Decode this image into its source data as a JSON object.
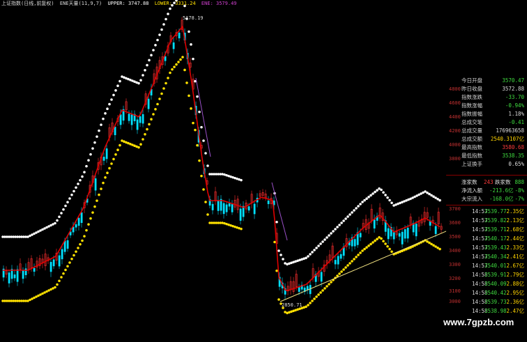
{
  "header": {
    "title": "上证指数(日线,前复权)",
    "indicator": "ENE天量(11,9,7)",
    "upper": "UPPER: 3747.88",
    "lower": "LOWER: 3331.24",
    "ene": "ENE: 3579.49"
  },
  "annotations": {
    "high": "5178.19",
    "low": "2850.71"
  },
  "price_axis": [
    "4800",
    "4600",
    "4400",
    "4200",
    "4000",
    "3800",
    "3600",
    "3400",
    "3200",
    "3000",
    "3700",
    "3600",
    "3500",
    "3400",
    "3300",
    "3200",
    "3100",
    "3000"
  ],
  "quote": [
    {
      "label": "今日开盘",
      "value": "3570.47",
      "color": "#3fdc3f"
    },
    {
      "label": "昨日收盘",
      "value": "3572.88",
      "color": "#dddddd"
    },
    {
      "label": "指数涨跌",
      "value": "-33.70",
      "color": "#3fdc3f"
    },
    {
      "label": "指数涨幅",
      "value": "-0.94%",
      "color": "#3fdc3f"
    },
    {
      "label": "指数振幅",
      "value": "1.18%",
      "color": "#dddddd"
    },
    {
      "label": "总成交笔",
      "value": "-0.41",
      "color": "#3fdc3f"
    },
    {
      "label": "总成交量",
      "value": "176963658",
      "color": "#dddddd"
    },
    {
      "label": "总成交额",
      "value": "2540.3107亿",
      "color": "#ffd400"
    },
    {
      "label": "最高指数",
      "value": "3580.68",
      "color": "#ff3b3b"
    },
    {
      "label": "最低指数",
      "value": "3538.35",
      "color": "#3fdc3f"
    },
    {
      "label": "上证换手",
      "value": "0.65%",
      "color": "#dddddd"
    }
  ],
  "breadth": {
    "up_label": "涨家数",
    "up_value": "243",
    "down_label": "跌家数",
    "down_value": "888",
    "net_label": "净流入额",
    "net_value": "-213.6亿",
    "net_pct": "-8%",
    "big_label": "大宗流入",
    "big_value": "-168.0亿",
    "big_pct": "-7%"
  },
  "ticks": [
    {
      "time": "14:57",
      "price": "3539.77",
      "vol": "2.35亿"
    },
    {
      "time": "14:57",
      "price": "3539.82",
      "vol": "2.13亿"
    },
    {
      "time": "14:57",
      "price": "3539.71",
      "vol": "2.68亿"
    },
    {
      "time": "14:57",
      "price": "3540.17",
      "vol": "2.44亿"
    },
    {
      "time": "14:57",
      "price": "3539.43",
      "vol": "2.33亿"
    },
    {
      "time": "14:57",
      "price": "3540.34",
      "vol": "2.41亿"
    },
    {
      "time": "14:57",
      "price": "3540.01",
      "vol": "2.67亿"
    },
    {
      "time": "14:58",
      "price": "3539.91",
      "vol": "2.79亿"
    },
    {
      "time": "14:58",
      "price": "3540.09",
      "vol": "2.88亿"
    },
    {
      "time": "14:58",
      "price": "3540.42",
      "vol": "2.95亿"
    },
    {
      "time": "14:58",
      "price": "3539.73",
      "vol": "2.36亿"
    },
    {
      "time": "14:58",
      "price": "3538.98",
      "vol": "2.47亿"
    }
  ],
  "watermark": "www.7gpzb.com",
  "colors": {
    "up": "#ff3030",
    "down": "#00e0ff",
    "upper": "#ffffff",
    "lower": "#ffe000",
    "mid": "#e00000",
    "trend": "#f0e080"
  }
}
